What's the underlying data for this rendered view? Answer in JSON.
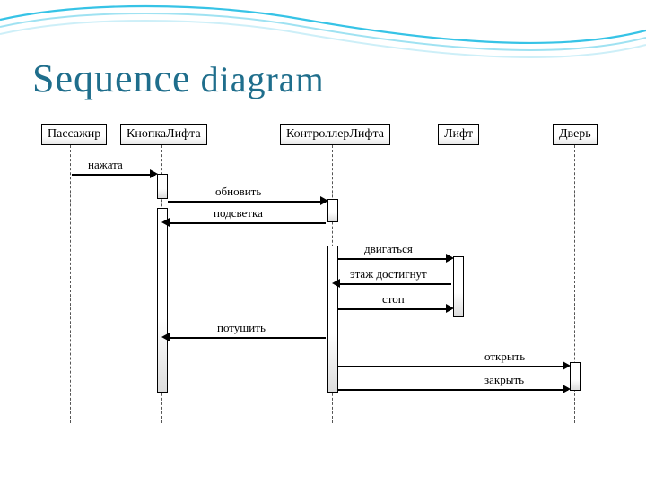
{
  "title": {
    "word1": "Sequence",
    "word2": "diagram"
  },
  "actors": [
    "Пассажир",
    "КнопкаЛифта",
    "КонтроллерЛифта",
    "Лифт",
    "Дверь"
  ],
  "messages": [
    {
      "from": "Пассажир",
      "to": "КнопкаЛифта",
      "label": "нажата"
    },
    {
      "from": "КнопкаЛифта",
      "to": "КонтроллерЛифта",
      "label": "обновить"
    },
    {
      "from": "КонтроллерЛифта",
      "to": "КнопкаЛифта",
      "label": "подсветка"
    },
    {
      "from": "КонтроллерЛифта",
      "to": "Лифт",
      "label": "двигаться"
    },
    {
      "from": "Лифт",
      "to": "КонтроллерЛифта",
      "label": "этаж достигнут"
    },
    {
      "from": "КонтроллерЛифта",
      "to": "Лифт",
      "label": "стоп"
    },
    {
      "from": "КонтроллерЛифта",
      "to": "КнопкаЛифта",
      "label": "потушить"
    },
    {
      "from": "КонтроллерЛифта",
      "to": "Дверь",
      "label": "открыть"
    },
    {
      "from": "КонтроллерЛифта",
      "to": "Дверь",
      "label": "закрыть"
    }
  ]
}
